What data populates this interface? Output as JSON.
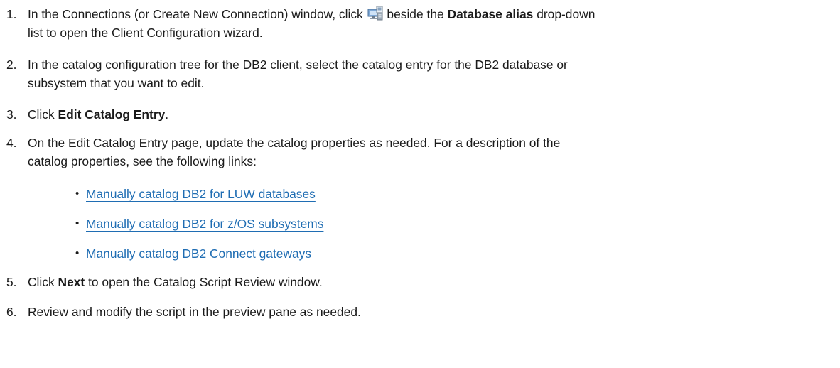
{
  "steps": [
    {
      "number": "1.",
      "lines": [
        {
          "before": "In the Connections (or Create New Connection) window, click",
          "after": "beside the",
          "bold": "Database alias",
          "tail": "drop-down"
        },
        "list to open the Client Configuration wizard."
      ],
      "icon": "client-configuration-icon"
    },
    {
      "number": "2.",
      "lines": [
        "In the catalog configuration tree for the DB2 client, select the catalog entry for the DB2 database or",
        "subsystem that you want to edit."
      ]
    },
    {
      "number": "3.",
      "prefix": "Click",
      "bold": "Edit Catalog Entry",
      "suffix": "."
    },
    {
      "number": "4.",
      "lines": [
        "On the Edit Catalog Entry page, update the catalog properties as needed. For a description of the",
        "catalog properties, see the following links:"
      ]
    },
    {
      "number": "5.",
      "prefix": "Click",
      "bold": "Next",
      "suffix": "to open the Catalog Script Review window."
    },
    {
      "number": "6.",
      "text": "Review and modify the script in the preview pane as needed."
    }
  ],
  "links": [
    "Manually catalog DB2 for LUW databases",
    "Manually catalog DB2 for z/OS subsystems",
    "Manually catalog DB2 Connect gateways"
  ],
  "colors": {
    "link": "#1f6db3",
    "text": "#1a1a1a"
  }
}
